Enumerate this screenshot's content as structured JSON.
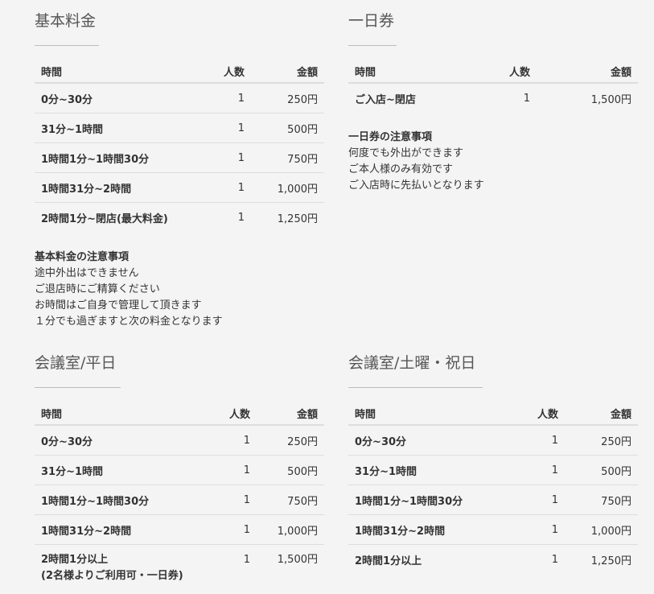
{
  "basic": {
    "title": "基本料金",
    "headers": {
      "time": "時間",
      "people": "人数",
      "price": "金額"
    },
    "rows": [
      {
        "time": "0分~30分",
        "people": "1",
        "price": "250円"
      },
      {
        "time": "31分~1時間",
        "people": "1",
        "price": "500円"
      },
      {
        "time": "1時間1分~1時間30分",
        "people": "1",
        "price": "750円"
      },
      {
        "time": "1時間31分~2時間",
        "people": "1",
        "price": "1,000円"
      },
      {
        "time": "2時間1分~閉店(最大料金)",
        "people": "1",
        "price": "1,250円"
      }
    ],
    "notes": {
      "title": "基本料金の注意事項",
      "lines": [
        "途中外出はできません",
        "ご退店時にご精算ください",
        "お時間はご自身で管理して頂きます",
        "１分でも過ぎますと次の料金となります"
      ]
    }
  },
  "dayPass": {
    "title": "一日券",
    "headers": {
      "time": "時間",
      "people": "人数",
      "price": "金額"
    },
    "rows": [
      {
        "time": "ご入店~閉店",
        "people": "1",
        "price": "1,500円"
      }
    ],
    "notes": {
      "title": "一日券の注意事項",
      "lines": [
        "何度でも外出ができます",
        "ご本人様のみ有効です",
        "ご入店時に先払いとなります"
      ]
    }
  },
  "meetingWeekday": {
    "title": "会議室/平日",
    "headers": {
      "time": "時間",
      "people": "人数",
      "price": "金額"
    },
    "rows": [
      {
        "time": "0分~30分",
        "people": "1",
        "price": "250円"
      },
      {
        "time": "31分~1時間",
        "people": "1",
        "price": "500円"
      },
      {
        "time": "1時間1分~1時間30分",
        "people": "1",
        "price": "750円"
      },
      {
        "time": "1時間31分~2時間",
        "people": "1",
        "price": "1,000円"
      },
      {
        "time": "2時間1分以上",
        "time2": "(2名様よりご利用可・一日券)",
        "people": "1",
        "price": "1,500円"
      }
    ]
  },
  "meetingWeekend": {
    "title": "会議室/土曜・祝日",
    "headers": {
      "time": "時間",
      "people": "人数",
      "price": "金額"
    },
    "rows": [
      {
        "time": "0分~30分",
        "people": "1",
        "price": "250円"
      },
      {
        "time": "31分~1時間",
        "people": "1",
        "price": "500円"
      },
      {
        "time": "1時間1分~1時間30分",
        "people": "1",
        "price": "750円"
      },
      {
        "time": "1時間31分~2時間",
        "people": "1",
        "price": "1,000円"
      },
      {
        "time": "2時間1分以上",
        "people": "1",
        "price": "1,250円"
      }
    ]
  }
}
